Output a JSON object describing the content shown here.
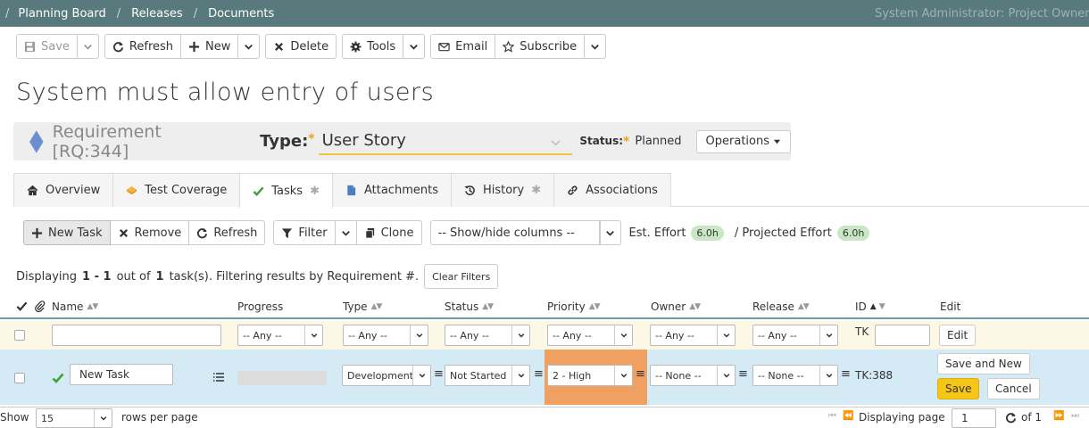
{
  "breadcrumb": {
    "items": [
      "Planning Board",
      "Releases",
      "Documents"
    ],
    "separator": "/"
  },
  "user_label": "System Administrator: Project Owner",
  "toolbar": {
    "save": "Save",
    "refresh": "Refresh",
    "new": "New",
    "delete": "Delete",
    "tools": "Tools",
    "email": "Email",
    "subscribe": "Subscribe"
  },
  "page_title": "System must allow entry of users",
  "requirement": {
    "id_label": "Requirement [RQ:344]",
    "type_label": "Type:",
    "type_value": "User Story",
    "status_label": "Status:",
    "status_value": "Planned",
    "operations": "Operations",
    "required_mark": "*",
    "diamond_color": "#6b8fcf"
  },
  "tabs": [
    {
      "label": "Overview",
      "icon": "home-icon",
      "active": false
    },
    {
      "label": "Test Coverage",
      "icon": "coverage-icon",
      "active": false
    },
    {
      "label": "Tasks",
      "icon": "check-icon",
      "active": true,
      "mark": "✱"
    },
    {
      "label": "Attachments",
      "icon": "file-icon",
      "active": false
    },
    {
      "label": "History",
      "icon": "history-icon",
      "active": false,
      "mark": "✱"
    },
    {
      "label": "Associations",
      "icon": "link-icon",
      "active": false
    }
  ],
  "task_toolbar": {
    "new_task": "New Task",
    "remove": "Remove",
    "refresh": "Refresh",
    "filter": "Filter",
    "clone": "Clone",
    "columns": "-- Show/hide columns --",
    "est_effort_label": "Est. Effort",
    "est_effort_value": "6.0h",
    "projected_effort_label": "/ Projected Effort",
    "projected_effort_value": "6.0h"
  },
  "displaying": {
    "prefix": "Displaying",
    "range": "1 - 1",
    "mid": "out of",
    "total": "1",
    "suffix": "task(s). Filtering results by Requirement #.",
    "clear_filters": "Clear Filters"
  },
  "columns": {
    "name": "Name",
    "progress": "Progress",
    "type": "Type",
    "status": "Status",
    "priority": "Priority",
    "owner": "Owner",
    "release": "Release",
    "id": "ID",
    "edit": "Edit"
  },
  "filters": {
    "any": "-- Any --",
    "id_prefix": "TK",
    "edit": "Edit"
  },
  "task": {
    "name": "New Task",
    "type": "Development",
    "status": "Not Started",
    "priority": "2 - High",
    "owner": "-- None --",
    "release": "-- None --",
    "id": "TK:388",
    "save_and_new": "Save and New",
    "save": "Save",
    "cancel": "Cancel",
    "progress": 0,
    "priority_color": "#f0a060"
  },
  "footer": {
    "show": "Show",
    "rows_value": "15",
    "rows_label": "rows per page",
    "displaying_page": "Displaying page",
    "page": "1",
    "of": "of 1"
  }
}
